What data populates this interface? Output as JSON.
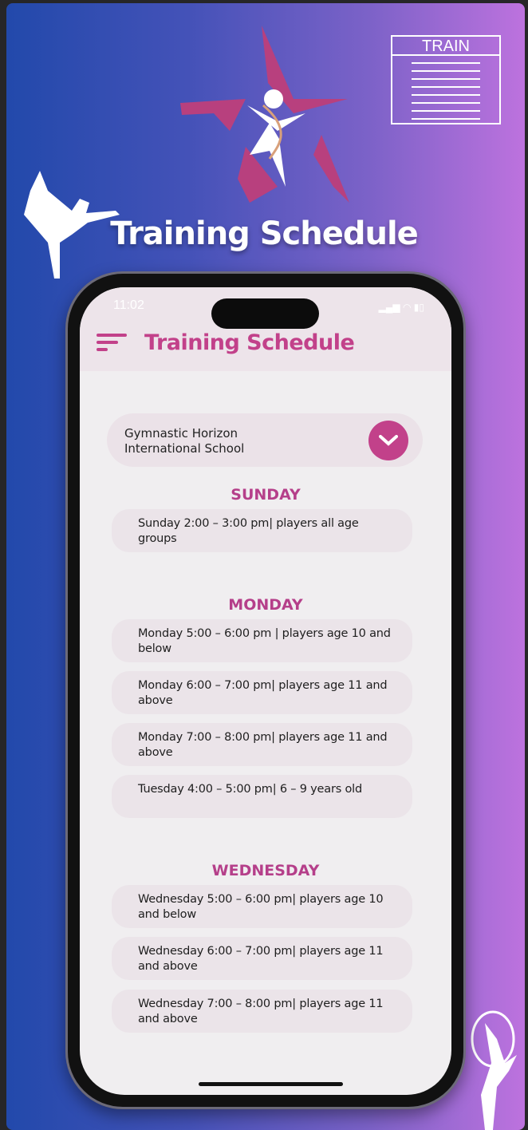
{
  "hero": {
    "title": "Training Schedule",
    "calendar_label": "TRAIN",
    "logo": "gymnast-star-logo"
  },
  "status_bar": {
    "time": "11:02",
    "icons": [
      "signal-icon",
      "wifi-icon",
      "battery-icon"
    ]
  },
  "app": {
    "title": "Training Schedule",
    "school_select": {
      "value": "Gymnastic Horizon International School"
    },
    "days": [
      {
        "name": "SUNDAY",
        "sessions": [
          "Sunday 2:00 – 3:00 pm| players all age groups"
        ]
      },
      {
        "name": "MONDAY",
        "sessions": [
          "Monday 5:00 – 6:00 pm | players age 10 and below",
          "Monday 6:00 – 7:00 pm| players age 11 and above",
          "Monday 7:00 – 8:00 pm| players age 11 and above",
          "Tuesday 4:00 – 5:00 pm| 6 – 9 years old"
        ]
      },
      {
        "name": "WEDNESDAY",
        "sessions": [
          "Wednesday 5:00 – 6:00 pm| players age 10 and below",
          "Wednesday 6:00 – 7:00 pm| players age 11 and above",
          "Wednesday 7:00 – 8:00 pm| players age 11 and above"
        ]
      }
    ]
  },
  "colors": {
    "accent": "#c2418a",
    "gradient_start": "#2249ab",
    "gradient_end": "#bd72de"
  }
}
